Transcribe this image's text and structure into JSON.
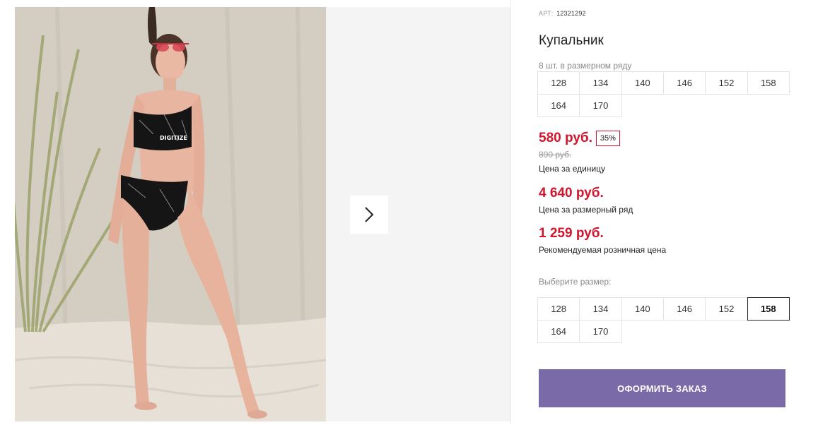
{
  "product": {
    "art_label": "АРТ:",
    "art_value": "12321292",
    "title": "Купальник",
    "range_note": "8 шт. в размерном ряду",
    "range_sizes": [
      "128",
      "134",
      "140",
      "146",
      "152",
      "158",
      "164",
      "170"
    ],
    "print_text": "DIGITIZE"
  },
  "pricing": {
    "unit_price": "580 руб.",
    "discount": "35%",
    "old_price": "890 руб.",
    "unit_caption": "Цена за единицу",
    "range_price": "4 640 руб.",
    "range_caption": "Цена за размерный ряд",
    "retail_price": "1 259 руб.",
    "retail_caption": "Рекомендуемая розничная цена"
  },
  "size_select": {
    "label": "Выберите размер:",
    "sizes": [
      "128",
      "134",
      "140",
      "146",
      "152",
      "158",
      "164",
      "170"
    ],
    "selected": "158"
  },
  "actions": {
    "order_label": "ОФОРМИТЬ ЗАКАЗ"
  },
  "gallery": {
    "next_icon": "chevron-right-icon"
  },
  "colors": {
    "price_red": "#d2142d",
    "order_button": "#7a6aa8",
    "gallery_bg": "#f4f4f4"
  }
}
